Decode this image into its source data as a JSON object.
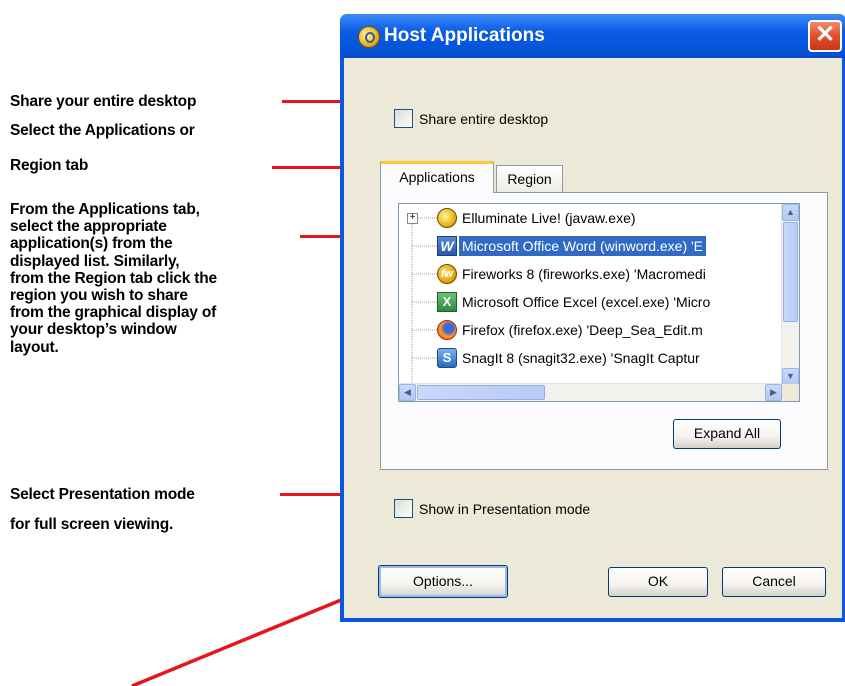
{
  "annotations": {
    "desktop": "Share your entire desktop",
    "tab_line1": "Select the Applications or",
    "tab_line2": "Region tab",
    "list_lines": [
      "From the Applications tab,",
      "select the appropriate",
      "application(s) from the",
      "displayed list.  Similarly,",
      "from the Region tab click the",
      "region you wish to share",
      "from the graphical display of",
      "your desktop’s window",
      "layout."
    ],
    "presentation_line1": "Select Presentation mode",
    "presentation_line2": "for full screen viewing."
  },
  "dialog": {
    "title": "Host Applications",
    "close_glyph": "✕",
    "share_desktop_label": "Share entire desktop",
    "tabs": [
      {
        "label": "Applications",
        "active": true
      },
      {
        "label": "Region",
        "active": false
      }
    ],
    "app_list": [
      {
        "label": "Elluminate Live! (javaw.exe)",
        "icon": "elluminate-icon",
        "selected": false
      },
      {
        "label": "Microsoft Office Word (winword.exe) 'E",
        "icon": "word-icon",
        "selected": true
      },
      {
        "label": "Fireworks 8 (fireworks.exe) 'Macromedi",
        "icon": "fireworks-icon",
        "selected": false
      },
      {
        "label": "Microsoft Office Excel (excel.exe) 'Micro",
        "icon": "excel-icon",
        "selected": false
      },
      {
        "label": "Firefox (firefox.exe) 'Deep_Sea_Edit.m",
        "icon": "firefox-icon",
        "selected": false
      },
      {
        "label": "SnagIt 8 (snagit32.exe) 'SnagIt Captur",
        "icon": "snagit-icon",
        "selected": false
      }
    ],
    "expand_all_label": "Expand All",
    "presentation_label": "Show in Presentation mode",
    "options_label": "Options...",
    "ok_label": "OK",
    "cancel_label": "Cancel"
  },
  "colors": {
    "arrow_red": "#e8141c",
    "titlebar_blue": "#0a5ce6",
    "selection_blue": "#316ac5",
    "dialog_face": "#ece9d8"
  }
}
